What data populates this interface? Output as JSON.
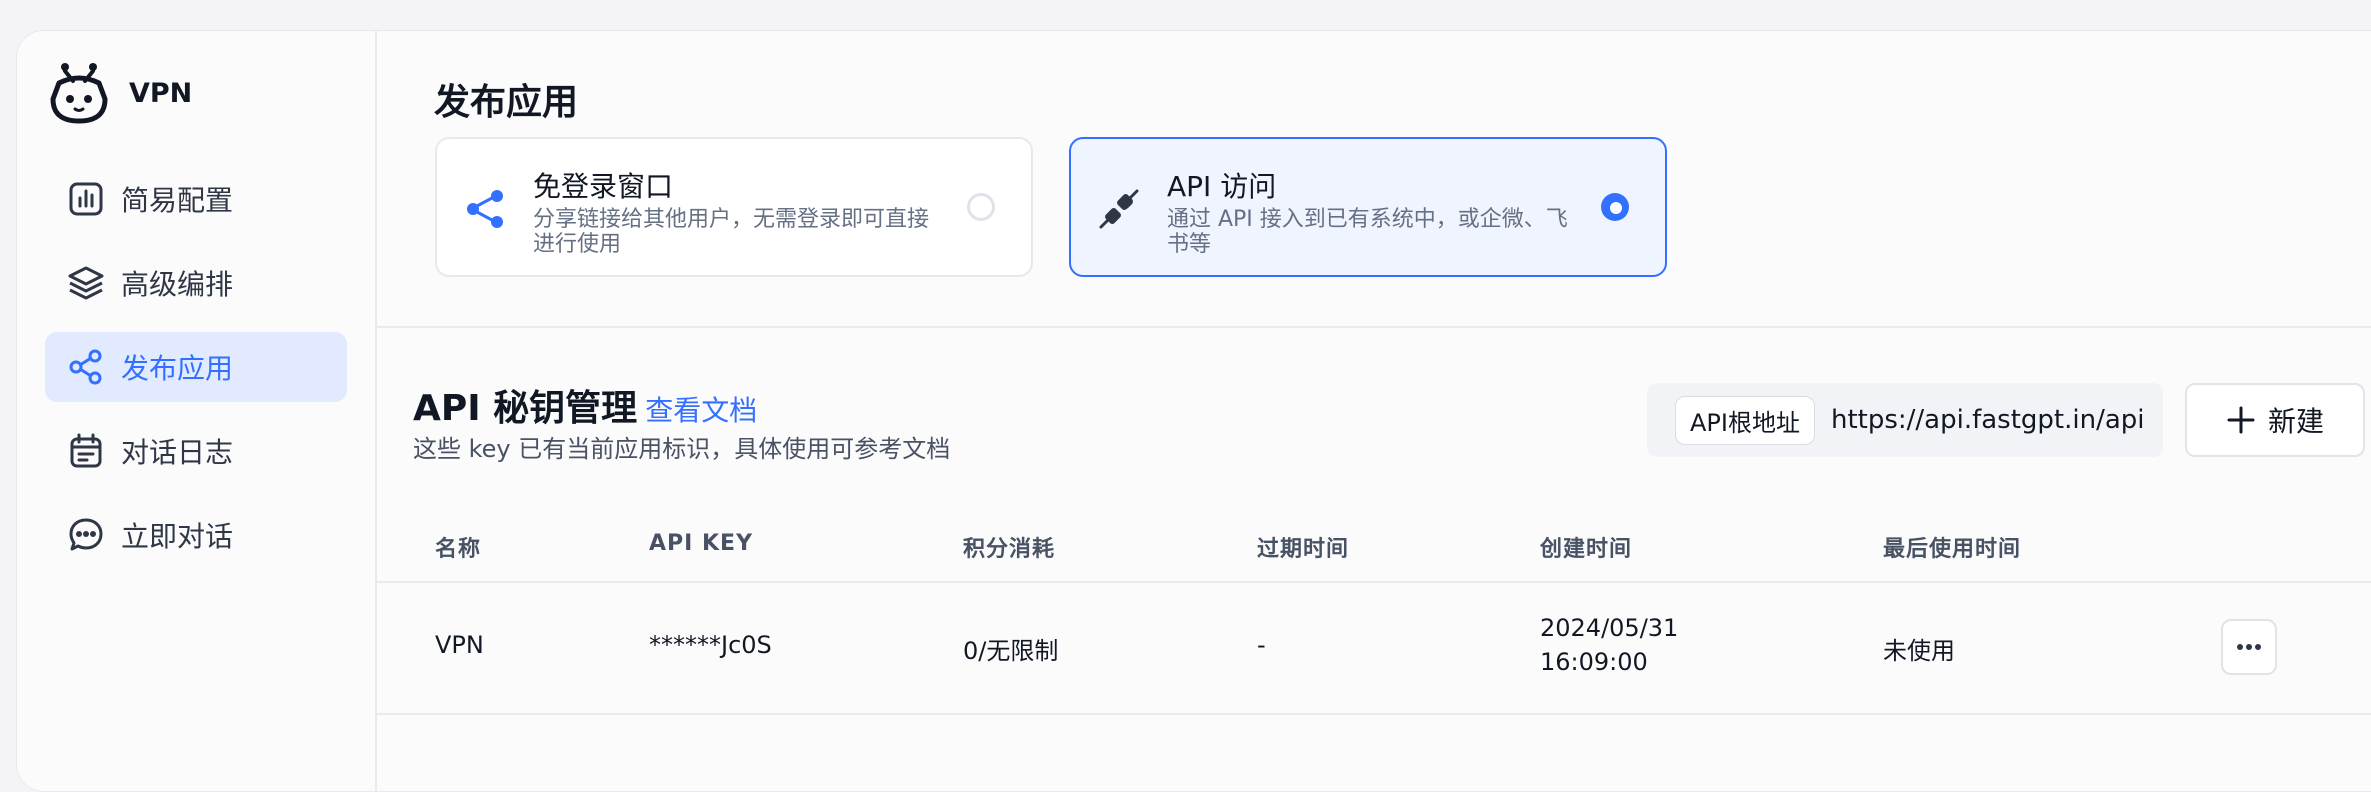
{
  "app": {
    "name": "VPN",
    "logo_icon": "robot-logo-icon"
  },
  "sidebar": {
    "items": [
      {
        "label": "简易配置",
        "icon": "bar-chart-icon",
        "active": false
      },
      {
        "label": "高级编排",
        "icon": "layers-icon",
        "active": false
      },
      {
        "label": "发布应用",
        "icon": "share-icon",
        "active": true
      },
      {
        "label": "对话日志",
        "icon": "calendar-log-icon",
        "active": false
      },
      {
        "label": "立即对话",
        "icon": "chat-bubble-icon",
        "active": false
      }
    ]
  },
  "publish": {
    "title": "发布应用",
    "options": [
      {
        "title": "免登录窗口",
        "desc": "分享链接给其他用户，无需登录即可直接进行使用",
        "icon": "share-icon",
        "selected": false
      },
      {
        "title": "API 访问",
        "desc": "通过 API 接入到已有系统中，或企微、飞书等",
        "icon": "plug-icon",
        "selected": true
      }
    ]
  },
  "api": {
    "title": "API 秘钥管理",
    "doc_link": "查看文档",
    "subtitle": "这些 key 已有当前应用标识，具体使用可参考文档",
    "base_url_tag": "API根地址",
    "base_url": "https://api.fastgpt.in/api",
    "new_button": "新建",
    "columns": [
      "名称",
      "API KEY",
      "积分消耗",
      "过期时间",
      "创建时间",
      "最后使用时间"
    ],
    "rows": [
      {
        "name": "VPN",
        "key": "******Jc0S",
        "usage": "0/无限制",
        "expire": "-",
        "created_date": "2024/05/31",
        "created_time": "16:09:00",
        "last_used": "未使用"
      }
    ]
  },
  "colors": {
    "accent": "#3370ff",
    "active_bg": "#e1eaff",
    "border": "#e6e8ee"
  }
}
